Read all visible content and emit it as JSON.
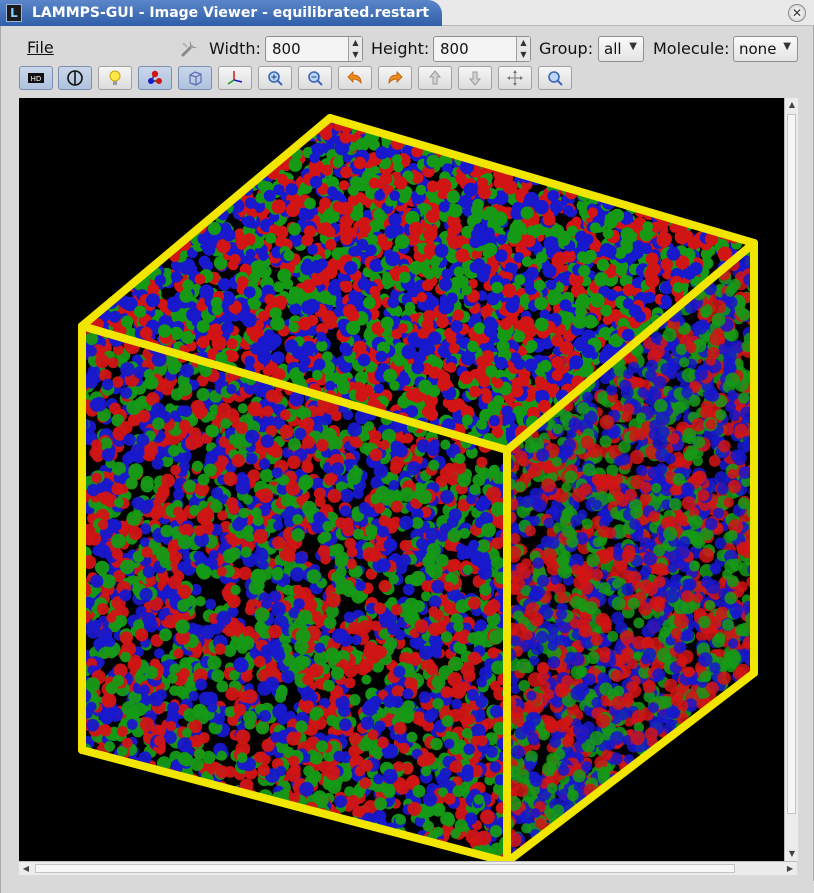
{
  "window": {
    "title": "LAMMPS-GUI - Image Viewer - equilibrated.restart"
  },
  "menu": {
    "file": "File"
  },
  "controls": {
    "width_label": "Width:",
    "width_value": "800",
    "height_label": "Height:",
    "height_value": "800",
    "group_label": "Group:",
    "group_value": "all",
    "molecule_label": "Molecule:",
    "molecule_value": "none"
  },
  "toolbar": {
    "buttons": [
      "hd-icon",
      "ssao-icon",
      "lightbulb-icon",
      "atoms-bonds-icon",
      "box-icon",
      "axes-icon",
      "zoom-in-icon",
      "zoom-out-icon",
      "rotate-left-icon",
      "rotate-right-icon",
      "rotate-up-icon",
      "rotate-down-icon",
      "recenter-icon",
      "reset-view-icon"
    ]
  },
  "colors": {
    "atom_red": "#d11515",
    "atom_green": "#169a16",
    "atom_blue": "#1818cc",
    "box_yellow": "#f2e600",
    "background": "#000000",
    "title_blue": "#2f5ea9"
  }
}
